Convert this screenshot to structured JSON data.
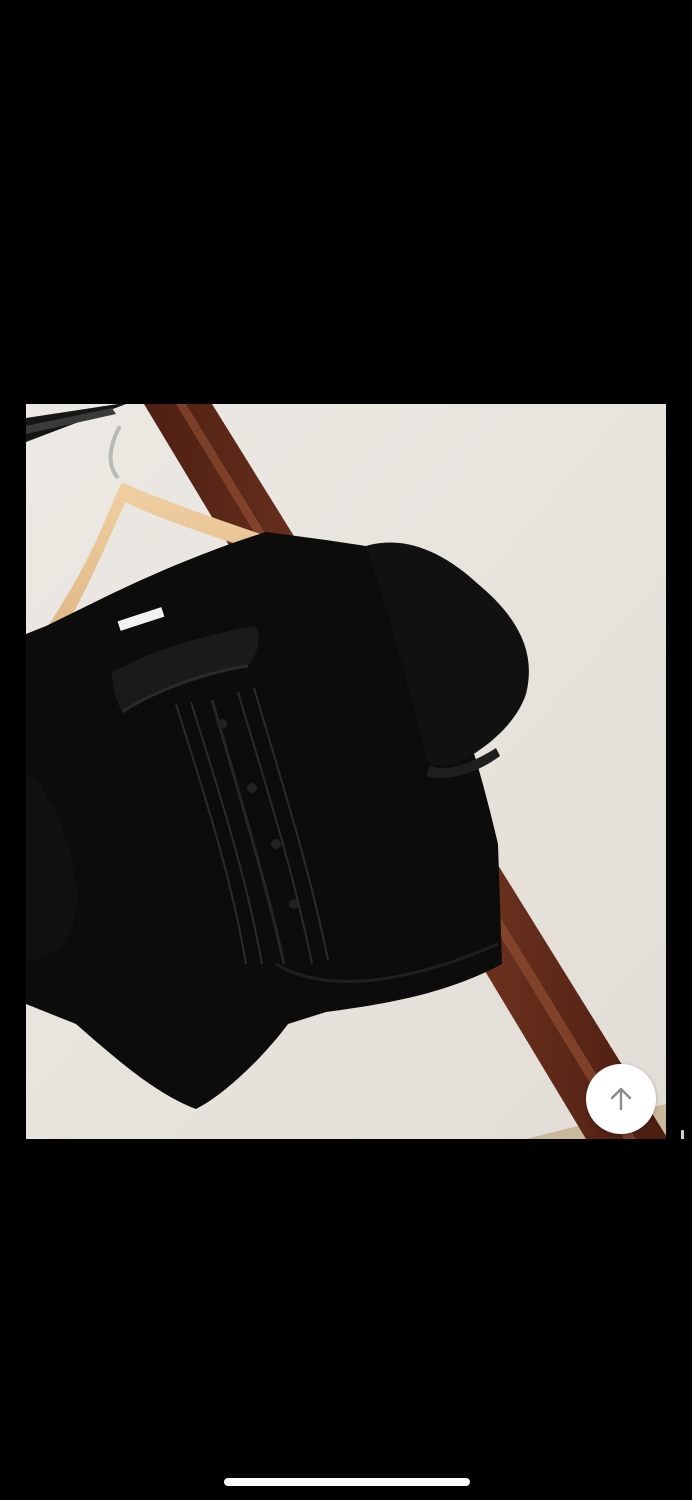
{
  "viewer": {
    "background_color": "#000000",
    "photo": {
      "subject": "product-photo",
      "background_color": "#e9e6e1",
      "garment_color": "#0c0c0c",
      "hanger_color": "#e0b886",
      "stand_color": "#6a2f1d"
    },
    "scroll_top_button": {
      "icon": "arrow-up-icon",
      "icon_color": "#8a8a8a"
    },
    "home_indicator_color": "#ffffff"
  }
}
